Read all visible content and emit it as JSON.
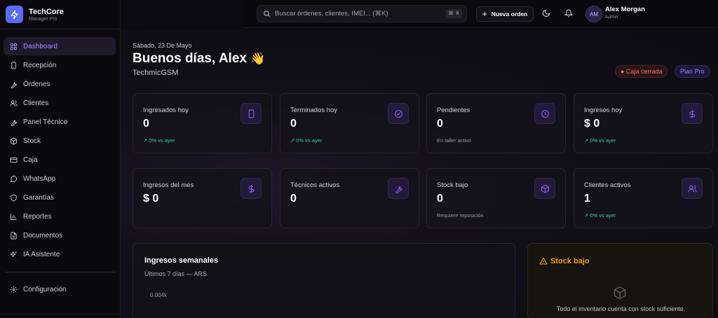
{
  "brand": {
    "name": "TechCore",
    "subtitle": "Manager Pro"
  },
  "sidebar": {
    "items": [
      {
        "label": "Dashboard",
        "icon": "dashboard-icon"
      },
      {
        "label": "Recepción",
        "icon": "phone-icon"
      },
      {
        "label": "Órdenes",
        "icon": "wrench-icon"
      },
      {
        "label": "Clientes",
        "icon": "users-icon"
      },
      {
        "label": "Panel Técnico",
        "icon": "wrench-icon"
      },
      {
        "label": "Stock",
        "icon": "box-icon"
      },
      {
        "label": "Caja",
        "icon": "wallet-icon"
      },
      {
        "label": "WhatsApp",
        "icon": "chat-icon"
      },
      {
        "label": "Garantías",
        "icon": "shield-icon"
      },
      {
        "label": "Reportes",
        "icon": "bar-chart-icon"
      },
      {
        "label": "Documentos",
        "icon": "document-icon"
      },
      {
        "label": "IA Asistente",
        "icon": "sparkles-icon"
      }
    ],
    "config_label": "Configuración"
  },
  "topbar": {
    "search_placeholder": "Buscar órdenes, clientes, IMEI... (⌘K)",
    "shortcut": "⌘ K",
    "new_order_label": "Nueva orden",
    "user": {
      "initials": "AM",
      "name": "Alex Morgan",
      "role": "Admin"
    }
  },
  "header": {
    "date": "Sábado, 23 De Mayo",
    "greeting": "Buenos días, Alex",
    "greeting_emoji": "👋",
    "shop": "TechmicGSM",
    "cash_status": "● Caja cerrada",
    "plan": "Plan Pro"
  },
  "stats": [
    {
      "label": "Ingresados hoy",
      "value": "0",
      "sub": "↗ 0% vs ayer",
      "trend": true,
      "icon": "phone-icon"
    },
    {
      "label": "Terminados hoy",
      "value": "0",
      "sub": "↗ 0% vs ayer",
      "trend": true,
      "icon": "check-circle-icon"
    },
    {
      "label": "Pendientes",
      "value": "0",
      "sub": "En taller activo",
      "trend": false,
      "icon": "clock-icon"
    },
    {
      "label": "Ingresos hoy",
      "value": "$ 0",
      "sub": "↗ 0% vs ayer",
      "trend": true,
      "icon": "dollar-icon"
    },
    {
      "label": "Ingresos del mes",
      "value": "$ 0",
      "sub": "",
      "trend": false,
      "icon": "dollar-icon"
    },
    {
      "label": "Técnicos activos",
      "value": "0",
      "sub": "",
      "trend": false,
      "icon": "wrench-icon"
    },
    {
      "label": "Stock bajo",
      "value": "0",
      "sub": "Requiere reposición",
      "trend": false,
      "icon": "box-icon"
    },
    {
      "label": "Clientes activos",
      "value": "1",
      "sub": "↗ 0% vs ayer",
      "trend": true,
      "icon": "users-icon"
    }
  ],
  "weekly": {
    "title": "Ingresos semanales",
    "subtitle": "Últimos 7 días — ARS",
    "tick": "0.004k"
  },
  "low_stock": {
    "title": "Stock bajo",
    "empty": "Todo el inventario cuenta con stock suficiente."
  },
  "colors": {
    "accent": "#a78bfa",
    "brand": "#5b6cf2",
    "trend": "#34d399",
    "warning": "#f59e0b",
    "danger": "#f26b6b"
  }
}
